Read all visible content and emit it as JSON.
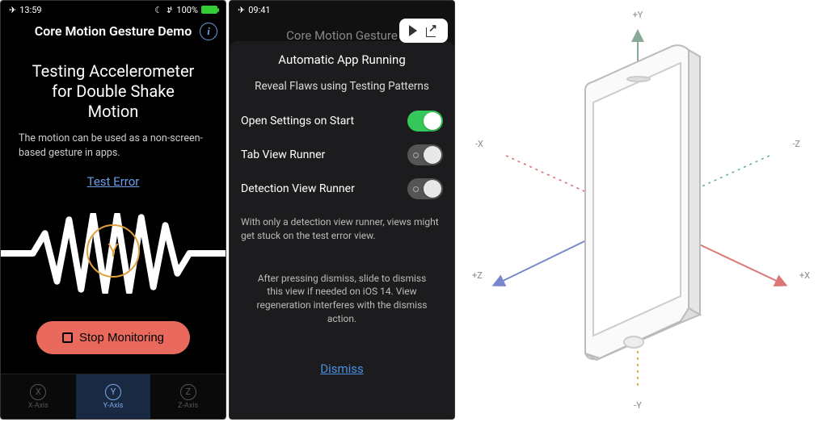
{
  "screen1": {
    "status": {
      "time": "13:59",
      "battery": "100%"
    },
    "header": {
      "title": "Core Motion Gesture Demo"
    },
    "heading": "Testing Accelerometer\nfor Double Shake Motion",
    "heading_l1": "Testing Accelerometer",
    "heading_l2": "for Double Shake Motion",
    "subtitle": "The motion can be used as a non-screen-based gesture in apps.",
    "test_error": "Test Error",
    "axis_letter": "Y",
    "stop_button": "Stop Monitoring",
    "tabs": [
      {
        "letter": "X",
        "label": "X-Axis"
      },
      {
        "letter": "Y",
        "label": "Y-Axis"
      },
      {
        "letter": "Z",
        "label": "Z-Axis"
      }
    ]
  },
  "screen2": {
    "status": {
      "time": "09:41"
    },
    "dimmed": "Core Motion Gesture",
    "sheet_title": "Automatic App Running",
    "sheet_subtitle": "Reveal Flaws using Testing Patterns",
    "settings": [
      {
        "label": "Open Settings on Start",
        "on": true
      },
      {
        "label": "Tab View Runner",
        "on": false
      },
      {
        "label": "Detection View Runner",
        "on": false
      }
    ],
    "note1": "With only a detection view runner, views might get stuck on the test error view.",
    "note2": "After pressing dismiss, slide to dismiss this view if needed on iOS 14. View regeneration interferes with the dismiss action.",
    "dismiss": "Dismiss"
  },
  "diagram": {
    "labels": {
      "py": "+Y",
      "ny": "-Y",
      "px": "+X",
      "nx": "-X",
      "pz": "+Z",
      "nz": "-Z"
    }
  }
}
